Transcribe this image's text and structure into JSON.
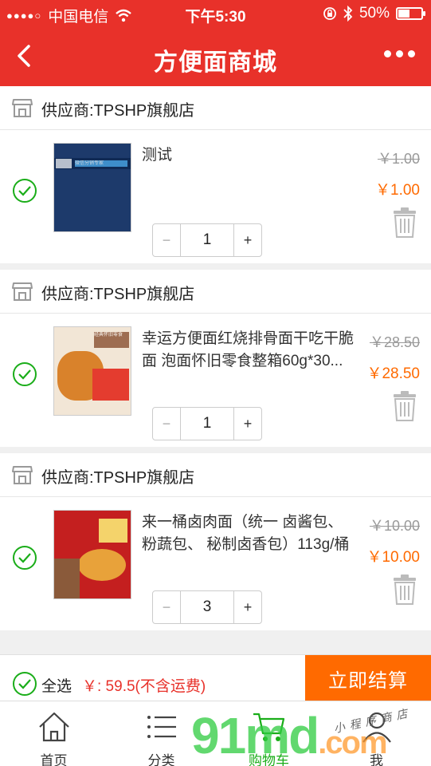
{
  "status_bar": {
    "signal": "●●●●○",
    "carrier": "中国电信",
    "time": "下午5:30",
    "battery": "50%",
    "battery_level": 0.5
  },
  "nav": {
    "title": "方便面商城"
  },
  "stores": [
    {
      "supplier": "供应商:TPSHP旗舰店",
      "product": "测试",
      "thumb_text": "微信分销专家",
      "old_price": "￥1.00",
      "price": "￥1.00",
      "qty": "1"
    },
    {
      "supplier": "供应商:TPSHP旗舰店",
      "product": "幸运方便面红烧排骨面干吃干脆面 泡面怀旧零食整箱60g*30...",
      "thumb_text": "经典怀旧零食",
      "old_price": "￥28.50",
      "price": "￥28.50",
      "qty": "1"
    },
    {
      "supplier": "供应商:TPSHP旗舰店",
      "product": "来一桶卤肉面（统一 卤酱包、粉蔬包、 秘制卤香包）113g/桶",
      "old_price": "￥10.00",
      "price": "￥10.00",
      "qty": "3"
    }
  ],
  "footer": {
    "select_all": "全选",
    "total": "￥: 59.5(不含运费)",
    "checkout": "立即结算"
  },
  "tabs": [
    {
      "label": "首页",
      "icon": "home-icon"
    },
    {
      "label": "分类",
      "icon": "list-icon"
    },
    {
      "label": "购物车",
      "icon": "cart-icon"
    },
    {
      "label": "我",
      "icon": "user-icon"
    }
  ],
  "watermark": {
    "text": "91md",
    "suffix": ".com",
    "sub": "小程序商店"
  },
  "colors": {
    "brand_red": "#e8312a",
    "price_orange": "#ff6a00",
    "check_green": "#1aad19"
  }
}
